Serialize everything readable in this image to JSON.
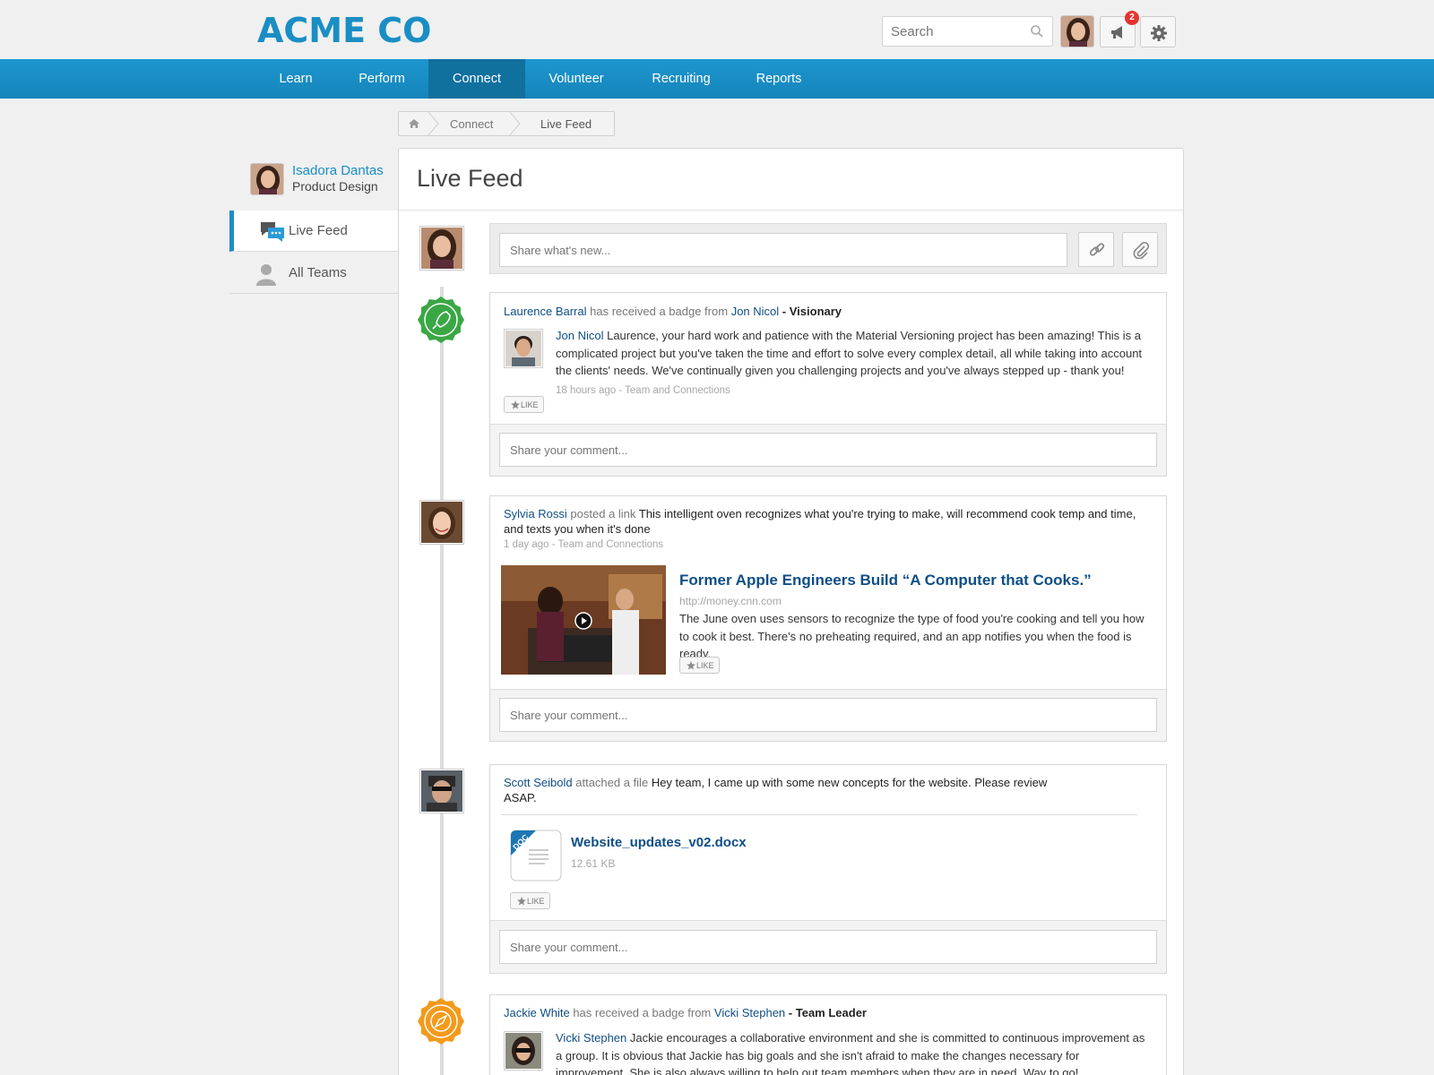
{
  "brand": {
    "logo": "ACME CO",
    "accent": "#1a8ec4"
  },
  "header": {
    "search_placeholder": "Search",
    "notification_count": "2",
    "icons": [
      "search-icon",
      "megaphone-icon",
      "gear-icon"
    ]
  },
  "nav": [
    {
      "label": "Learn"
    },
    {
      "label": "Perform"
    },
    {
      "label": "Connect",
      "active": true
    },
    {
      "label": "Volunteer"
    },
    {
      "label": "Recruiting"
    },
    {
      "label": "Reports"
    }
  ],
  "breadcrumb": [
    "Connect",
    "Live Feed"
  ],
  "profile": {
    "name": "Isadora Dantas",
    "role": "Product Design"
  },
  "sidebar": [
    {
      "label": "Live Feed",
      "icon": "chat-bubbles-icon",
      "active": true
    },
    {
      "label": "All Teams",
      "icon": "person-icon"
    }
  ],
  "main": {
    "title": "Live Feed",
    "share_placeholder": "Share what's new...",
    "comment_placeholder": "Share your comment..."
  },
  "posts": [
    {
      "type": "badge",
      "actor": "Laurence Barral",
      "verb": "has received a badge from",
      "from": "Jon Nicol",
      "dash": "-",
      "badge_name": "Visionary",
      "author": "Jon Nicol",
      "text": "Laurence, your hard work and patience with the Material Versioning project has been amazing! This is a complicated project but you've taken the time and effort to solve every complex detail, all while taking into account the clients' needs. We've continually given you challenging projects and you've always stepped up - thank you!",
      "meta": "18 hours ago - Team and Connections",
      "like": "LIKE"
    },
    {
      "type": "link",
      "actor": "Sylvia Rossi",
      "verb": "posted a link",
      "text": "This intelligent oven recognizes what you're trying to make, will recommend cook temp and time, and texts you when it's done",
      "meta": "1 day ago - Team and Connections",
      "link_title": "Former Apple Engineers Build “A Computer that Cooks.”",
      "link_url": "http://money.cnn.com",
      "link_desc": "The June oven uses sensors to recognize the type of food you're cooking and tell you how to cook it best. There's no preheating required, and an app notifies you when the food is ready.",
      "like": "LIKE"
    },
    {
      "type": "file",
      "actor": "Scott Seibold",
      "verb": "attached a file",
      "text": "Hey team, I came up with some new concepts for the website. Please review ASAP.",
      "file_name": "Website_updates_v02.docx",
      "file_size": "12.61 KB",
      "file_badge": "DOC",
      "like": "LIKE"
    },
    {
      "type": "badge",
      "actor": "Jackie White",
      "verb": "has received a badge from",
      "from": "Vicki Stephen",
      "dash": "-",
      "badge_name": "Team Leader",
      "author": "Vicki Stephen",
      "text": "Jackie encourages a collaborative environment and she is committed to continuous improvement as a group. It is obvious that Jackie has big goals and she isn't afraid to make the changes necessary for improvement. She is also always willing to help out team members when they are in need. Way to go!"
    }
  ]
}
